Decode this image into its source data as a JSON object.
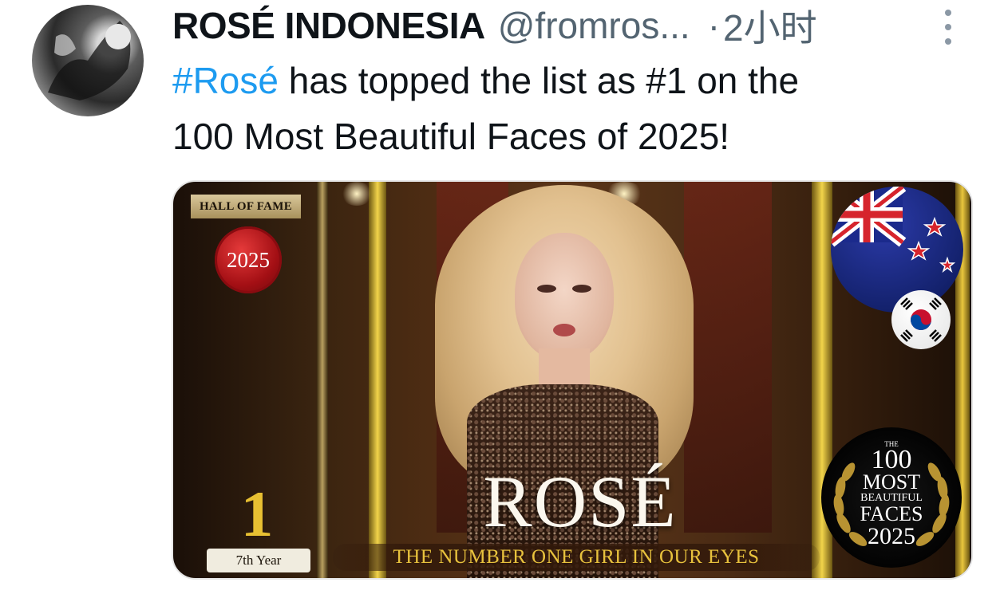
{
  "tweet": {
    "author_name": "ROSÉ INDONESIA",
    "author_handle": "@fromros...",
    "separator": "·",
    "time": "2小时",
    "text_hashtag": "#Rosé",
    "text_line1_rest": " has topped the list as #1 on the",
    "text_line2": "100 Most Beautiful Faces of 2025!"
  },
  "media": {
    "hall_of_fame": "HALL OF FAME",
    "seal_year": "2025",
    "rank": "1",
    "rank_year": "7th Year",
    "name_title": "ROSÉ",
    "subtitle": "THE NUMBER ONE GIRL IN OUR EYES",
    "badge_the": "THE",
    "badge_100": "100",
    "badge_most": "MOST",
    "badge_beautiful": "BEAUTIFUL",
    "badge_faces": "FACES",
    "badge_year": "2025"
  },
  "colors": {
    "hashtag": "#1d9bf0",
    "secondary_text": "#536471",
    "gold_text": "#e8c032"
  },
  "icons": {
    "more": "more-options-icon"
  }
}
